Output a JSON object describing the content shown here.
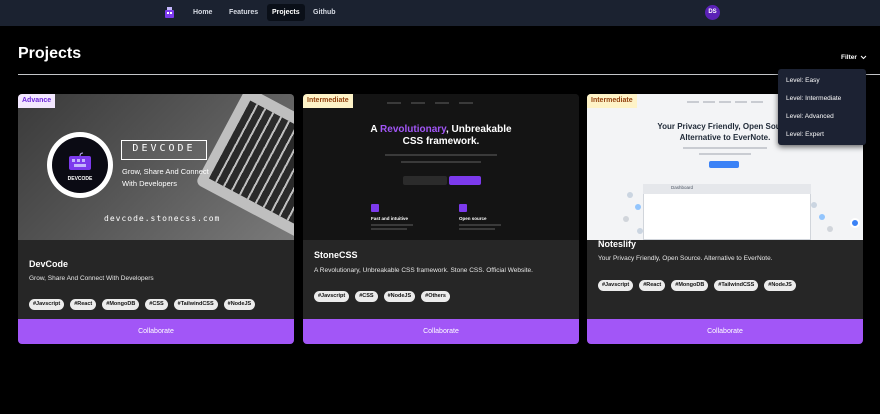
{
  "navbar": {
    "links": [
      "Home",
      "Features",
      "Projects",
      "Github"
    ],
    "active": "Projects",
    "avatar_initials": "DS",
    "avatar_color": "#5b21b6"
  },
  "header": {
    "title": "Projects",
    "filter_label": "Filter"
  },
  "filter_menu": {
    "items": [
      "Level: Easy",
      "Level: Intermediate",
      "Level: Advanced",
      "Level: Expert"
    ]
  },
  "colors": {
    "accent": "#a256f7",
    "advance_badge_bg": "#f3e8ff",
    "advance_badge_text": "#6d28d9",
    "intermediate_badge_bg": "#fef3c7",
    "intermediate_badge_text": "#92400e"
  },
  "projects": [
    {
      "level": "Advance",
      "title": "DevCode",
      "description": "Grow, Share And Connect With Developers",
      "tags": [
        "#Javscript",
        "#React",
        "#MongoDB",
        "#CSS",
        "#TailwindCSS",
        "#NodeJS"
      ],
      "action": "Collaborate",
      "image": {
        "name": "DEVCODE",
        "tagline_line1": "Grow, Share And Connect",
        "tagline_line2": "With Developers",
        "url": "devcode.stonecss.com",
        "logo_text": "DEVCODE"
      }
    },
    {
      "level": "Intermediate",
      "title": "StoneCSS",
      "description": "A Revolutionary, Unbreakable CSS framework. Stone CSS. Official Website.",
      "tags": [
        "#Javscript",
        "#CSS",
        "#NodeJS",
        "#Others"
      ],
      "action": "Collaborate",
      "image": {
        "headline_plain": "A ",
        "headline_accent": "Revolutionary",
        "headline_rest": ", Unbreakable",
        "headline_line2": "CSS framework.",
        "feature1": "Fast and intuitive",
        "feature2": "Open source"
      }
    },
    {
      "level": "Intermediate",
      "title": "Noteslify",
      "description": "Your Privacy Friendly, Open Source. Alternative to EverNote.",
      "tags": [
        "#Javscript",
        "#React",
        "#MongoDB",
        "#TailwindCSS",
        "#NodeJS"
      ],
      "action": "Collaborate",
      "image": {
        "headline_line1": "Your Privacy Friendly, Open Source",
        "headline_line2": "Alternative to EverNote.",
        "app_label": "Dashboard"
      }
    }
  ]
}
